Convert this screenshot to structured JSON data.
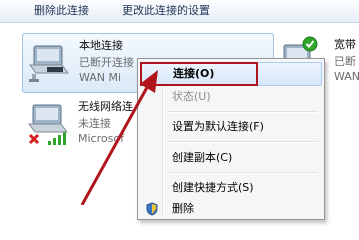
{
  "toolbar": {
    "delete_label": "删除此连接",
    "change_settings_label": "更改此连接的设置"
  },
  "connections": [
    {
      "title": "本地连接",
      "status": "已断开连接",
      "device": "WAN Mi"
    },
    {
      "title": "无线网络连",
      "status": "未连接",
      "device": "Microsof"
    },
    {
      "title": "宽带",
      "status": "已断",
      "device": "WAN"
    }
  ],
  "context_menu": {
    "items": [
      {
        "label": "连接(O)",
        "highlighted": true
      },
      {
        "label": "状态(U)",
        "disabled": true
      },
      {
        "label": "设置为默认连接(F)"
      },
      {
        "label": "创建副本(C)"
      },
      {
        "label": "创建快捷方式(S)"
      },
      {
        "label": "删除"
      }
    ]
  },
  "colors": {
    "annotation_red": "#b0141c",
    "selection_blue": "#9ec3e6",
    "status_green": "#2fa52a"
  }
}
